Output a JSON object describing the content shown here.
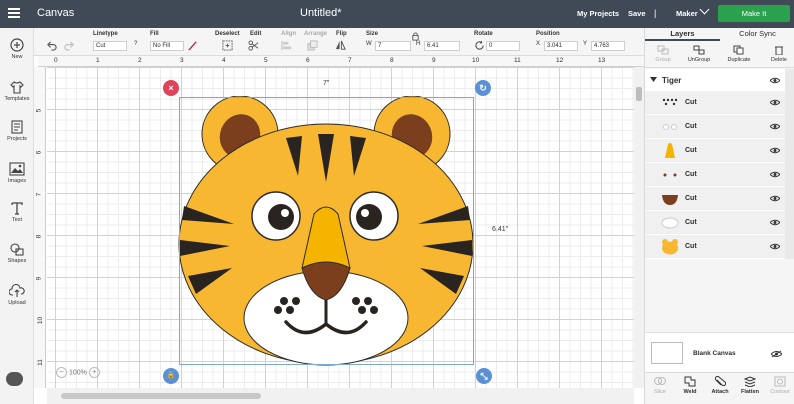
{
  "topbar": {
    "app_title": "Canvas",
    "doc_title": "Untitled*",
    "my_projects": "My Projects",
    "save": "Save",
    "separator": "|",
    "machine": "Maker",
    "make_it": "Make It",
    "colors": {
      "bar": "#404a57",
      "make_it": "#2aa14c"
    }
  },
  "toolbar": {
    "linetype_label": "Linetype",
    "linetype_value": "Cut",
    "help": "?",
    "fill_label": "Fill",
    "fill_value": "No Fill",
    "deselect": "Deselect",
    "edit": "Edit",
    "align": "Align",
    "arrange": "Arrange",
    "flip": "Flip",
    "size_label": "Size",
    "w_label": "W",
    "w_value": "7",
    "h_label": "H",
    "h_value": "6.41",
    "rotate_label": "Rotate",
    "rotate_value": "0",
    "position_label": "Position",
    "x_label": "X",
    "x_value": "3.041",
    "y_label": "Y",
    "y_value": "4.763"
  },
  "leftbar": {
    "items": [
      {
        "label": "New",
        "icon": "plus-icon"
      },
      {
        "label": "Templates",
        "icon": "shirt-icon"
      },
      {
        "label": "Projects",
        "icon": "projects-icon"
      },
      {
        "label": "Images",
        "icon": "image-icon"
      },
      {
        "label": "Text",
        "icon": "text-icon"
      },
      {
        "label": "Shapes",
        "icon": "shapes-icon"
      },
      {
        "label": "Upload",
        "icon": "upload-icon"
      }
    ]
  },
  "ruler": {
    "top": [
      "0",
      "1",
      "2",
      "3",
      "4",
      "5",
      "6",
      "7",
      "8",
      "9",
      "10",
      "11",
      "12",
      "13"
    ],
    "left": [
      "5",
      "6",
      "7",
      "8",
      "9",
      "10",
      "11"
    ]
  },
  "canvas": {
    "width_dim": "7\"",
    "height_dim": "6.41\"",
    "zoom": "100%",
    "zoom_minus": "−",
    "zoom_plus": "+",
    "handles": {
      "delete": "×",
      "rotate": "↻",
      "lock": "🔒",
      "scale": "⤡"
    }
  },
  "rpanel": {
    "tabs": [
      "Layers",
      "Color Sync"
    ],
    "actions": [
      {
        "label": "Group",
        "enabled": false
      },
      {
        "label": "UnGroup",
        "enabled": true
      },
      {
        "label": "Duplicate",
        "enabled": true
      },
      {
        "label": "Delete",
        "enabled": true
      }
    ],
    "group_name": "Tiger",
    "layers": [
      {
        "label": "Cut",
        "thumb": "dots"
      },
      {
        "label": "Cut",
        "thumb": "eyes-white"
      },
      {
        "label": "Cut",
        "thumb": "nose"
      },
      {
        "label": "Cut",
        "thumb": "small-dots"
      },
      {
        "label": "Cut",
        "thumb": "mouth"
      },
      {
        "label": "Cut",
        "thumb": "muzzle"
      },
      {
        "label": "Cut",
        "thumb": "head"
      }
    ],
    "blank_canvas": "Blank Canvas",
    "bottom_actions": [
      {
        "label": "Slice",
        "enabled": false
      },
      {
        "label": "Weld",
        "enabled": true
      },
      {
        "label": "Attach",
        "enabled": true
      },
      {
        "label": "Flatten",
        "enabled": true
      },
      {
        "label": "Contour",
        "enabled": false
      }
    ]
  },
  "colors": {
    "head": "#f7b731",
    "outline": "#2b2b2b",
    "ear_inner": "#7b3f1e",
    "nose": "#f4b400",
    "nose_tip": "#7b3f1e",
    "stripe": "#2a2420",
    "muzzle": "#ffffff",
    "selection": "#7fa7d4",
    "handle_delete": "#e0425a",
    "handle_other": "#5b8fd6"
  }
}
